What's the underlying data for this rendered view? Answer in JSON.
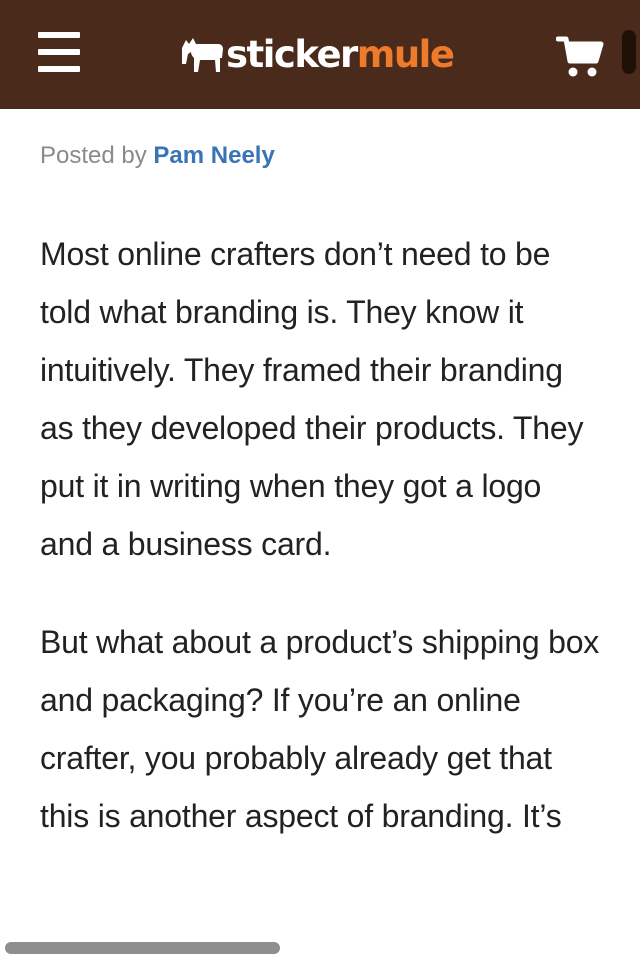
{
  "header": {
    "menu_icon": "hamburger-menu-icon",
    "logo_icon": "mule-icon",
    "logo_part1": "sticker",
    "logo_part2": "mule",
    "cart_icon": "shopping-cart-icon",
    "colors": {
      "bar": "#4a2a1a",
      "logo_accent": "#ee7a2c",
      "author_link": "#3b74b5"
    }
  },
  "article": {
    "byline_prefix": "Posted by",
    "author": "Pam Neely",
    "paragraphs": [
      "Most online crafters don’t need to be told what branding is. They know it intuitively. They framed their branding as they developed their products. They put it in writing when they got a logo and a business card.",
      "But what about a product’s shipping box and packaging? If you’re an online crafter, you probably already get that this is another aspect of branding. It’s"
    ]
  }
}
